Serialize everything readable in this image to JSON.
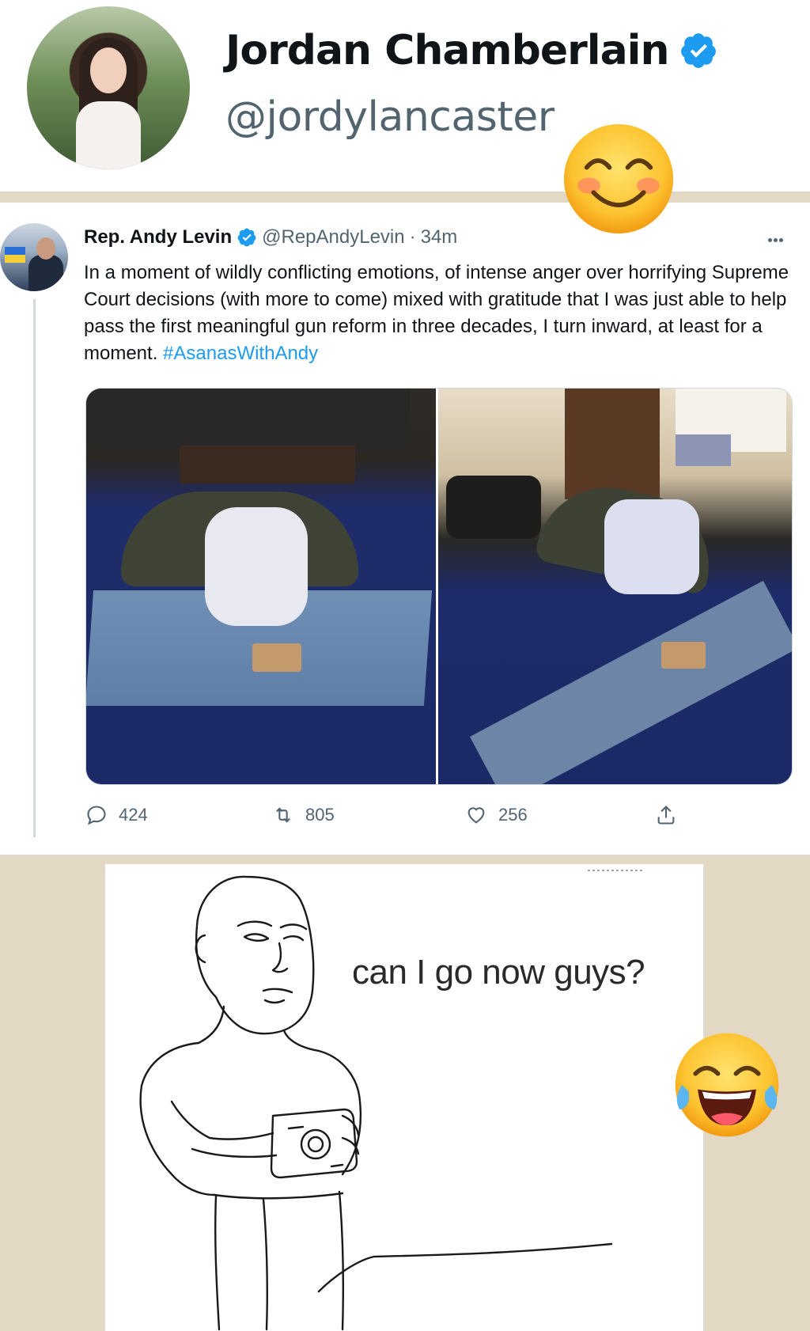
{
  "profile": {
    "name": "Jordan Chamberlain",
    "handle": "@jordylancaster"
  },
  "tweet": {
    "author": "Rep. Andy Levin",
    "handle": "@RepAndyLevin",
    "separator": "·",
    "time": "34m",
    "text": "In a moment of wildly conflicting emotions, of intense anger over horrifying Supreme Court decisions (with more to come) mixed with gratitude that I was just able to help pass the first meaningful gun reform in three decades, I turn inward, at least for a moment.",
    "hashtag": "#AsanasWithAndy",
    "replies": "424",
    "retweets": "805",
    "likes": "256"
  },
  "meme": {
    "caption": "can I go now guys?"
  },
  "icons": {
    "verified": "verified-badge-icon",
    "more": "more-icon",
    "reply": "reply-icon",
    "retweet": "retweet-icon",
    "like": "heart-icon",
    "share": "share-icon",
    "emoji_top": "smiling-blush-emoji",
    "emoji_bottom": "tears-of-joy-emoji"
  },
  "colors": {
    "verified_blue": "#1d9bf0",
    "muted_text": "#536471",
    "background_beige": "#e3d8c4"
  }
}
